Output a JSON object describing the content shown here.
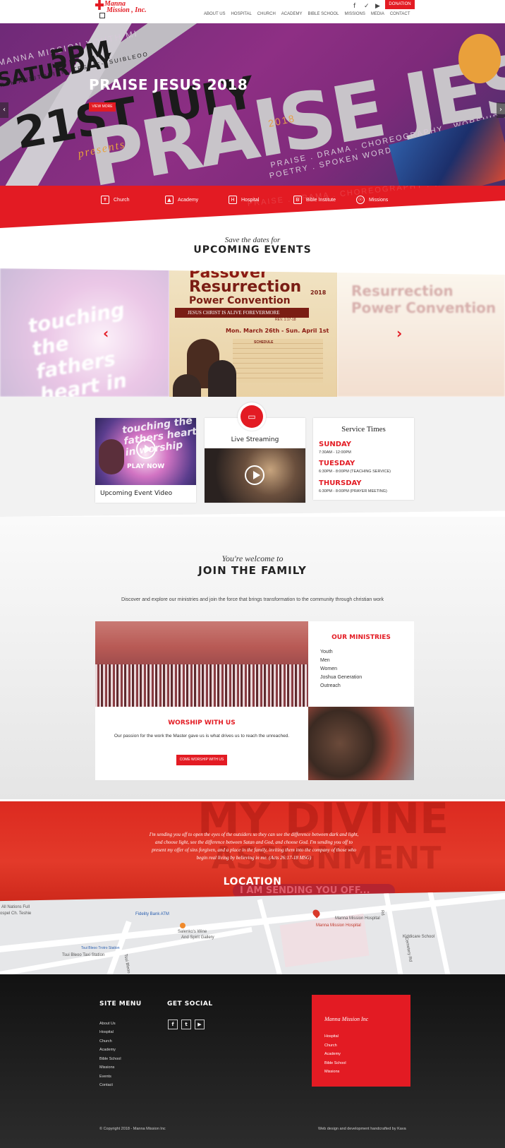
{
  "header": {
    "logo_line1": "Manna",
    "logo_line2": "Mission , Inc.",
    "social_icons": [
      "facebook-icon",
      "twitter-icon",
      "youtube-icon"
    ],
    "donate_label": "DONATION",
    "nav": [
      "ABOUT US",
      "HOSPITAL",
      "CHURCH",
      "ACADEMY",
      "BIBLE SCHOOL",
      "MISSIONS",
      "MEDIA",
      "CONTACT"
    ]
  },
  "hero": {
    "title": "PRAISE JESUS 2018",
    "button": "VIEW MORE",
    "poster_header": "MANNA MISSION YOUTH MI",
    "poster_venue": "URCH AUDITORIUM, TESHIE-TSUIBLEOO",
    "poster_day": "SATURDAY",
    "poster_date": "21ST JULY",
    "poster_time": "5PM",
    "poster_word": "PRAISE JESUS",
    "poster_year": "2018",
    "poster_presents": "presents",
    "poster_sub": "PRAISE . DRAMA . CHOREOGRAPHY . WORSHIP .",
    "poster_sub2": "POETRY . SPOKEN WORD ..."
  },
  "quicklinks": [
    {
      "label": "Church",
      "icon": "cross-icon"
    },
    {
      "label": "Academy",
      "icon": "graduation-cap-icon"
    },
    {
      "label": "Hospital",
      "icon": "hospital-icon"
    },
    {
      "label": "Bible Institute",
      "icon": "book-icon"
    },
    {
      "label": "Missions",
      "icon": "missions-icon"
    }
  ],
  "events": {
    "script": "Save the dates for",
    "title": "UPCOMING EVENTS",
    "center": {
      "line1": "Passover",
      "line2": "Resurrection",
      "line3": "Power Convention",
      "year": "2018",
      "tagline": "JESUS CHRIST IS ALIVE FOREVERMORE",
      "ref": "REV. 1:17-18",
      "dates": "Mon. March 26th - Sun. April 1st",
      "schedule_heading": "SCHEDULE"
    },
    "left_poster": "touching the fathers heart in worship",
    "right_poster": "Resurrection Power Convention"
  },
  "cards": {
    "video": {
      "play": "PLAY NOW",
      "caption": "Upcoming Event Video",
      "poster": "touching the fathers heart in worship"
    },
    "live": {
      "title": "Live Streaming",
      "icon": "video-camera-icon"
    },
    "service": {
      "title": "Service Times",
      "items": [
        {
          "day": "SUNDAY",
          "time": "7:30AM - 12:00PM"
        },
        {
          "day": "TUESDAY",
          "time": "6:30PM - 8:00PM (TEACHING SERVICE)"
        },
        {
          "day": "THURSDAY",
          "time": "6:30PM - 8:00PM (PRAYER MEETING)"
        }
      ]
    }
  },
  "join": {
    "script": "You're welcome to",
    "title": "JOIN THE FAMILY",
    "desc": "Discover and explore our ministries and join the force that brings transformation to the community through christian work",
    "ministries_title": "OUR MINISTRIES",
    "ministries": [
      "Youth",
      "Men",
      "Women",
      "Joshua Generation",
      "Outreach"
    ],
    "worship_title": "WORSHIP WITH US",
    "worship_desc": "Our passion for the work the Master gave us is what drives us to reach the unreached.",
    "worship_button": "COME WORSHIP WITH US"
  },
  "verse": {
    "bg_line1": "MY DIVINE",
    "bg_line2": "ASSIGNMENT",
    "text": "I'm sending you off to open the eyes of the outsiders so they can see the difference between dark and light, and choose light, see the difference between Satan and God, and choose God. I'm sending you off to present my offer of sins forgiven, and a place in the family, inviting them into the company of those who begin real living by believing in me. (Acts 26:17-18 MSG)",
    "location": "LOCATION",
    "sending": "I AM SENDING YOU OFF..."
  },
  "map": {
    "labels": {
      "allnations": "All Nations Full",
      "gospel": "ospel Ch. Teshie",
      "fidelity": "Fidelity Bank ATM",
      "salenko1": "Salenko's Wine",
      "salenko2": "And Spirit Gallery",
      "tsui1": "Tsui Bleoo Trotro Station",
      "tsui2": "Tsui Bleoo Taxi Station",
      "tsuibleoo": "Tsui Bleoo",
      "manna1": "Manna Mission Hospital",
      "manna2": "Manna Mission Hospital",
      "kiddicare": "Kiddicare School",
      "rd": "Rd",
      "cemetery": "Cemetery Rd"
    }
  },
  "footer": {
    "site_menu_title": "SITE MENU",
    "site_menu": [
      "About Us",
      "Hospital",
      "Church",
      "Academy",
      "Bible School",
      "Missions",
      "Events",
      "Contact"
    ],
    "social_title": "GET SOCIAL",
    "social_icons": [
      "facebook-icon",
      "twitter-icon",
      "youtube-icon"
    ],
    "box_title": "Manna Mission Inc",
    "box_links": [
      "Hospital",
      "Church",
      "Academy",
      "Bible School",
      "Missions"
    ],
    "copyright": "© Copyright 2018 - Manna Mission Inc",
    "credit": "Web design and development handcrafted by Kava"
  },
  "colors": {
    "accent": "#e31b23",
    "hero_purple": "#7d2a7a",
    "footer_dark": "#1a1a1a"
  }
}
